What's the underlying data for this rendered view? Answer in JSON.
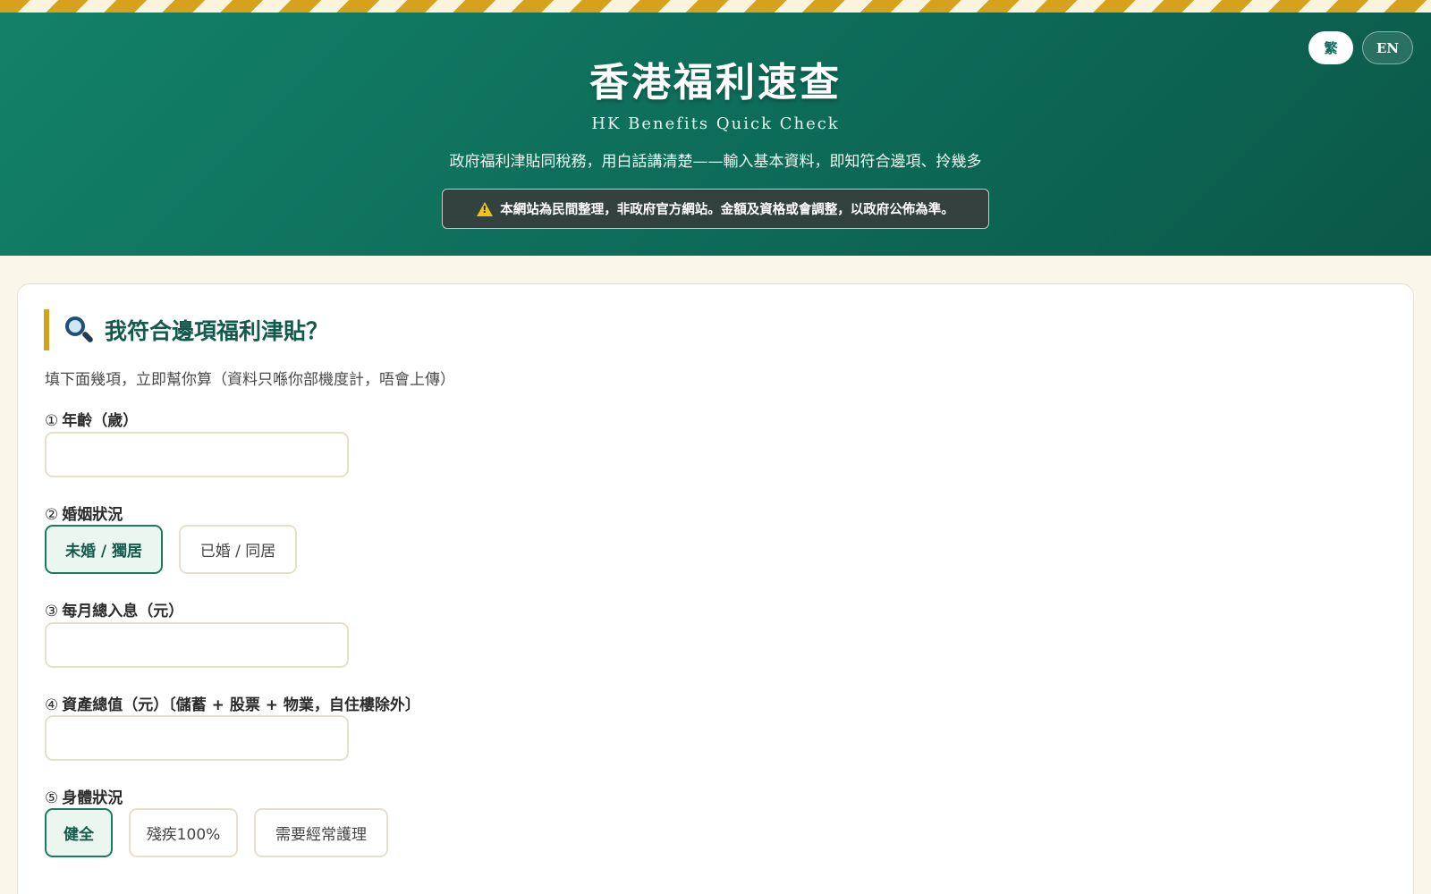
{
  "header": {
    "title": "香港福利速查",
    "subtitle": "HK Benefits Quick Check",
    "tagline": "政府福利津貼同稅務，用白話講清楚——輸入基本資料，即知符合邊項、拎幾多",
    "disclaimer": "本網站為民間整理，非政府官方網站。金額及資格或會調整，以政府公佈為準。",
    "lang_zh": "繁",
    "lang_en": "EN"
  },
  "colors": {
    "primary": "#0d6b58",
    "accent": "#d6a21e",
    "background": "#fbf6ea"
  },
  "form": {
    "title": "我符合邊項福利津貼？",
    "intro": "填下面幾項，立即幫你算（資料只喺你部機度計，唔會上傳）",
    "q1": {
      "num": "①",
      "label": "年齡（歲）",
      "value": ""
    },
    "q2": {
      "num": "②",
      "label": "婚姻狀況",
      "options": [
        "未婚 / 獨居",
        "已婚 / 同居"
      ],
      "selected": "未婚 / 獨居"
    },
    "q3": {
      "num": "③",
      "label": "每月總入息（元）",
      "value": ""
    },
    "q4": {
      "num": "④",
      "label": "資產總值（元）〔儲蓄 + 股票 + 物業，自住樓除外〕",
      "value": ""
    },
    "q5": {
      "num": "⑤",
      "label": "身體狀況",
      "options": [
        "健全",
        "殘疾100%",
        "需要經常護理"
      ],
      "selected": "健全"
    }
  }
}
